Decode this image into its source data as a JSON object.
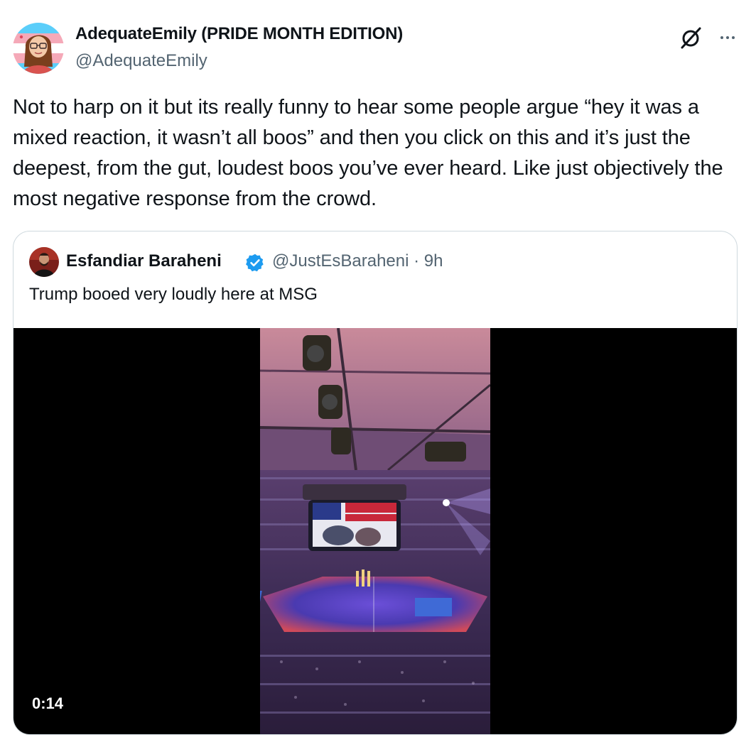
{
  "author": {
    "display_name": "AdequateEmily (PRIDE MONTH EDITION)",
    "handle": "@AdequateEmily"
  },
  "tweet": {
    "text": "Not to harp on it but its really funny to hear some people argue “hey it was a mixed reaction, it wasn’t all boos” and then you click on this and it’s just the deepest, from the gut, loudest boos you’ve ever heard. Like just objectively the most negative response from the crowd."
  },
  "quoted": {
    "display_name": "Esfandiar Baraheni",
    "handle_time": "@JustEsBaraheni · 9h",
    "text": "Trump booed very loudly here at MSG",
    "video": {
      "duration": "0:14"
    }
  },
  "icons": {
    "grok": "grok-icon",
    "more": "more-icon",
    "verified": "verified-badge-icon"
  },
  "colors": {
    "text": "#0f1419",
    "secondary": "#536471",
    "border": "#cfd9de",
    "verified": "#1d9bf0"
  }
}
